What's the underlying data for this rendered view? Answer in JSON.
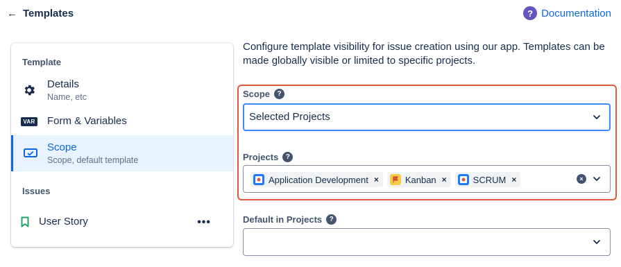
{
  "header": {
    "back_arrow": "←",
    "title": "Templates",
    "documentation_label": "Documentation",
    "documentation_icon": "?"
  },
  "sidebar": {
    "template_section": "Template",
    "items": [
      {
        "label": "Details",
        "sub": "Name, etc",
        "icon": "gear-icon"
      },
      {
        "label": "Form & Variables",
        "sub": "",
        "icon": "var-icon",
        "badge": "VAR"
      },
      {
        "label": "Scope",
        "sub": "Scope, default template",
        "icon": "scope-icon",
        "active": true
      }
    ],
    "issues_section": "Issues",
    "issues": [
      {
        "label": "User Story",
        "icon": "bookmark-icon",
        "more": "•••"
      }
    ]
  },
  "main": {
    "intro": "Configure template visibility for issue creation using our app. Templates can be made globally visible or limited to specific projects.",
    "scope": {
      "label": "Scope",
      "help": "?",
      "value": "Selected Projects"
    },
    "projects": {
      "label": "Projects",
      "help": "?",
      "tags": [
        {
          "label": "Application Development",
          "icon": "project-icon",
          "remove": "×"
        },
        {
          "label": "Kanban",
          "icon": "flag-icon",
          "remove": "×"
        },
        {
          "label": "SCRUM",
          "icon": "project-icon",
          "remove": "×"
        }
      ],
      "clear": "×"
    },
    "default_in_projects": {
      "label": "Default in Projects",
      "help": "?",
      "value": ""
    }
  },
  "colors": {
    "accent": "#0c66e4",
    "highlight_border": "#e2583e",
    "active_bg": "#e9f2ff",
    "doc_icon": "#6554c0"
  }
}
